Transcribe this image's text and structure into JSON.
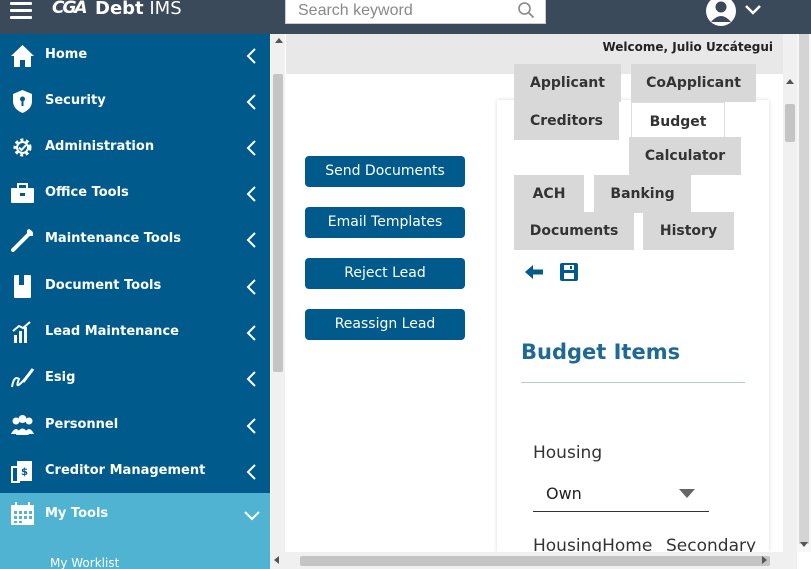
{
  "header": {
    "logo_text": "CGA",
    "app_name_bold": "Debt",
    "app_name_rest": " IMS",
    "search": {
      "placeholder": "Search keyword",
      "value": ""
    },
    "icons": {
      "menu": "hamburger-menu-icon",
      "search": "search-icon",
      "user": "user-avatar-icon",
      "caret": "chevron-down-icon"
    },
    "bg_color": "#3a4a5a"
  },
  "sidebar": {
    "bg_color": "#005b8c",
    "active_color": "#4fb3d1",
    "items": [
      {
        "label": "Home",
        "icon": "home-icon"
      },
      {
        "label": "Security",
        "icon": "shield-icon"
      },
      {
        "label": "Administration",
        "icon": "gear-icon"
      },
      {
        "label": "Office Tools",
        "icon": "briefcase-icon"
      },
      {
        "label": "Maintenance Tools",
        "icon": "wrench-icon"
      },
      {
        "label": "Document Tools",
        "icon": "book-icon"
      },
      {
        "label": "Lead Maintenance",
        "icon": "bar-chart-icon"
      },
      {
        "label": "Esig",
        "icon": "signature-icon"
      },
      {
        "label": "Personnel",
        "icon": "people-icon"
      },
      {
        "label": "Creditor Management",
        "icon": "dollar-document-icon"
      },
      {
        "label": "My Tools",
        "icon": "calendar-icon",
        "expanded": true
      }
    ],
    "sub_items": [
      {
        "label": "My Worklist"
      }
    ]
  },
  "welcome": {
    "text": "Welcome, Julio Uzcátegui"
  },
  "actions": {
    "send_documents": "Send Documents",
    "email_templates": "Email Templates",
    "reject_lead": "Reject Lead",
    "reassign_lead": "Reassign Lead",
    "button_color": "#005b8c"
  },
  "tabs": {
    "applicant": "Applicant",
    "coapplicant": "CoApplicant",
    "creditors": "Creditors",
    "budget": "Budget",
    "calculator": "Calculator",
    "ach": "ACH",
    "banking": "Banking",
    "documents": "Documents",
    "history": "History",
    "active": "Budget"
  },
  "panel_tools": {
    "back": "arrow-left-icon",
    "save": "save-icon"
  },
  "budget": {
    "title": "Budget Items",
    "housing_label": "Housing",
    "housing_value": "Own",
    "housing_home_label": "HousingHome",
    "secondary_label": "Secondary",
    "title_color": "#1f6a95"
  }
}
